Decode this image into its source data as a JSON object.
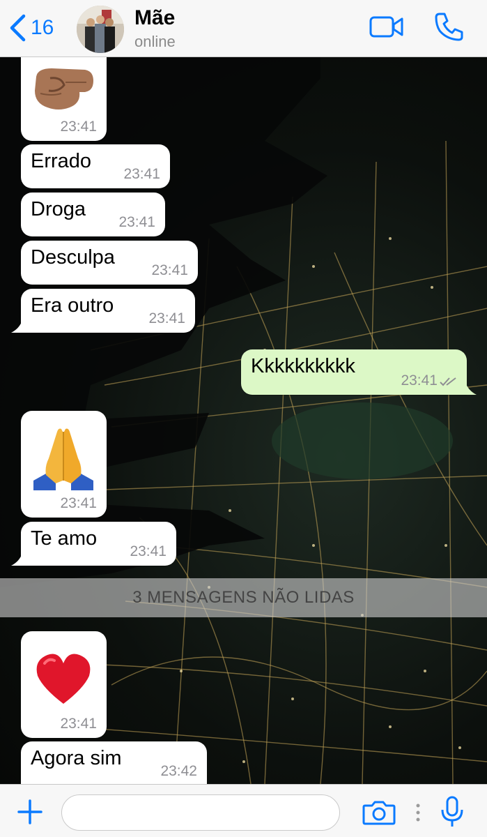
{
  "header": {
    "back_count": "16",
    "contact_name": "Mãe",
    "contact_status": "online"
  },
  "messages": [
    {
      "type": "emoji",
      "emoji": "fist-bump-emoji",
      "time": "23:41",
      "direction": "in"
    },
    {
      "type": "text",
      "text": "Errado",
      "time": "23:41",
      "direction": "in"
    },
    {
      "type": "text",
      "text": "Droga",
      "time": "23:41",
      "direction": "in"
    },
    {
      "type": "text",
      "text": "Desculpa",
      "time": "23:41",
      "direction": "in"
    },
    {
      "type": "text",
      "text": "Era outro",
      "time": "23:41",
      "direction": "in"
    },
    {
      "type": "text",
      "text": "Kkkkkkkkkk",
      "time": "23:41",
      "direction": "out",
      "read": true
    },
    {
      "type": "emoji",
      "emoji": "folded-hands-emoji",
      "time": "23:41",
      "direction": "in"
    },
    {
      "type": "text",
      "text": "Te amo",
      "time": "23:41",
      "direction": "in"
    },
    {
      "type": "emoji",
      "emoji": "red-heart-emoji",
      "time": "23:41",
      "direction": "in"
    },
    {
      "type": "text",
      "text": "Agora sim",
      "time": "23:42",
      "direction": "in"
    }
  ],
  "unread_divider": "3 MENSAGENS NÃO LIDAS",
  "colors": {
    "accent": "#0a7aff",
    "outgoing_bubble": "#dcf8c6",
    "incoming_bubble": "#ffffff",
    "read_ticks": "#8e8e93"
  },
  "icons": {
    "back": "chevron-left-icon",
    "video_call": "video-camera-icon",
    "voice_call": "phone-icon",
    "attach": "plus-icon",
    "camera": "camera-icon",
    "microphone": "microphone-icon"
  }
}
